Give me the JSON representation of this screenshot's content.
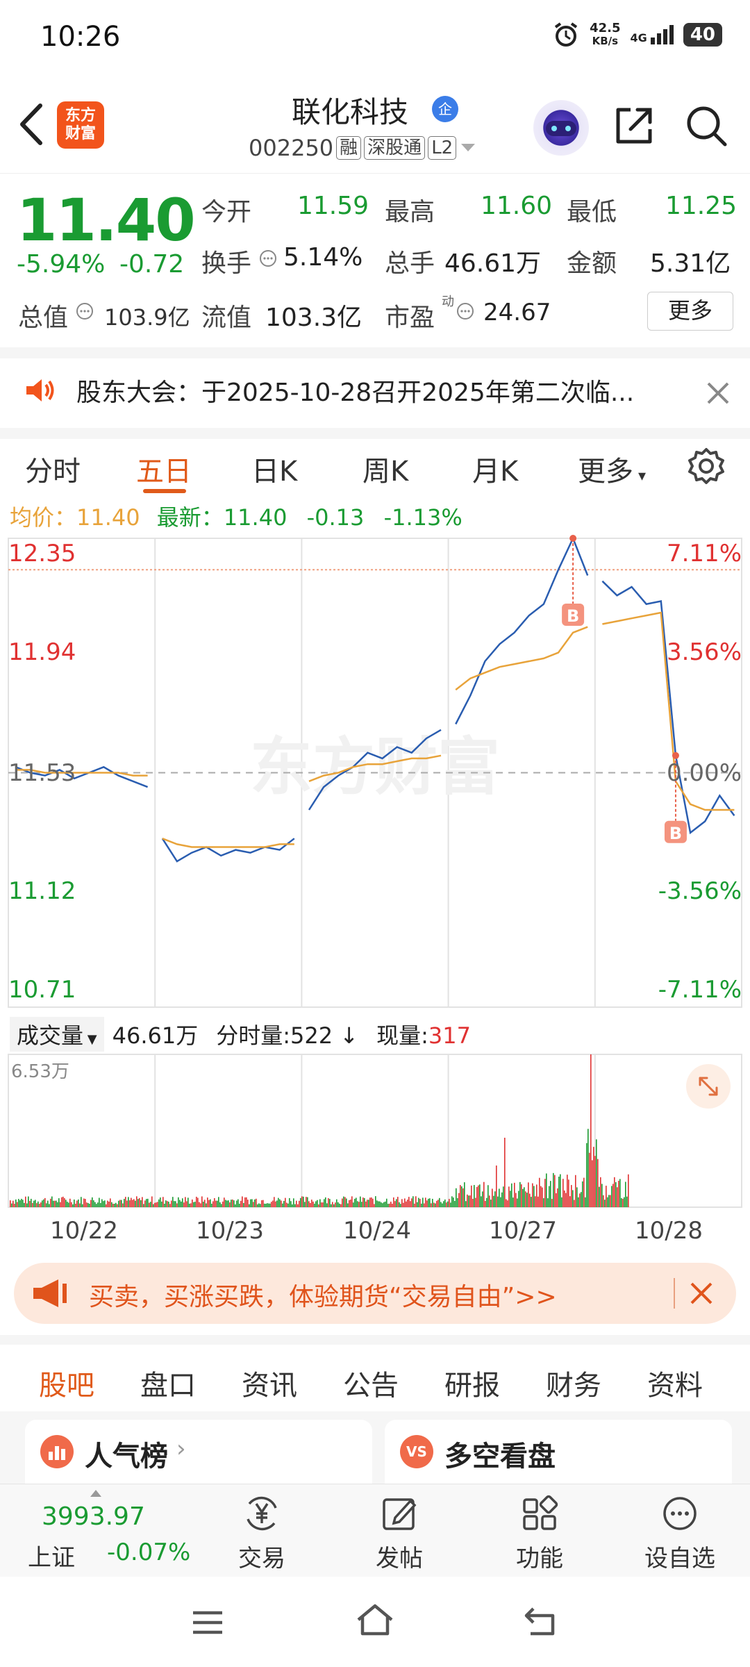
{
  "status_bar": {
    "time": "10:26",
    "net_speed": "42.5",
    "net_unit": "KB/s",
    "network": "4G",
    "battery": "40"
  },
  "header": {
    "stock_name": "联化科技",
    "qi_badge": "企",
    "stock_code": "002250",
    "tags": [
      "融",
      "深股通",
      "L2"
    ],
    "logo_line1": "东方",
    "logo_line2": "财富"
  },
  "quote": {
    "price": "11.40",
    "change_pct": "-5.94%",
    "change": "-0.72",
    "open_label": "今开",
    "open": "11.59",
    "high_label": "最高",
    "high": "11.60",
    "low_label": "最低",
    "low": "11.25",
    "turnover_label": "换手",
    "turnover": "5.14%",
    "volume_label": "总手",
    "volume": "46.61万",
    "amount_label": "金额",
    "amount": "5.31亿",
    "mcap_label": "总值",
    "mcap": "103.9亿",
    "float_label": "流值",
    "float_cap": "103.3亿",
    "pe_label": "市盈",
    "pe_sup": "动",
    "pe": "24.67",
    "more_label": "更多"
  },
  "notice": {
    "text": "股东大会：于2025-10-28召开2025年第二次临..."
  },
  "chart_tabs": [
    "分时",
    "五日",
    "日K",
    "周K",
    "月K",
    "更多"
  ],
  "avg_line": {
    "avg_label": "均价：",
    "avg": "11.40",
    "latest_label": "最新：",
    "latest": "11.40",
    "chg": "-0.13",
    "pct": "-1.13%"
  },
  "chart_data": {
    "type": "line",
    "title": "",
    "x": [
      "10/22",
      "10/23",
      "10/24",
      "10/27",
      "10/28"
    ],
    "ylim": [
      10.71,
      12.35
    ],
    "y_ticks_left": [
      "12.35",
      "11.94",
      "11.53",
      "11.12",
      "10.71"
    ],
    "y_ticks_right": [
      "7.11%",
      "3.56%",
      "0.00%",
      "-3.56%",
      "-7.11%"
    ],
    "base_price": 11.53,
    "series": [
      {
        "name": "",
        "color": "#2a5db0",
        "values": [
          11.55,
          11.53,
          11.52,
          11.54,
          11.51,
          11.53,
          11.55,
          11.52,
          11.5,
          11.48,
          11.3,
          11.22,
          11.25,
          11.27,
          11.24,
          11.26,
          11.25,
          11.27,
          11.26,
          11.3,
          11.4,
          11.48,
          11.52,
          11.55,
          11.6,
          11.58,
          11.62,
          11.6,
          11.65,
          11.68,
          11.7,
          11.8,
          11.92,
          11.98,
          12.02,
          12.08,
          12.12,
          12.24,
          12.35,
          12.22,
          12.2,
          12.15,
          12.18,
          12.12,
          12.13,
          11.59,
          11.32,
          11.36,
          11.45,
          11.38
        ]
      },
      {
        "name": "",
        "color": "#e8a33a",
        "values": [
          11.54,
          11.54,
          11.53,
          11.53,
          11.53,
          11.53,
          11.53,
          11.53,
          11.52,
          11.52,
          11.3,
          11.28,
          11.27,
          11.27,
          11.27,
          11.27,
          11.27,
          11.27,
          11.28,
          11.28,
          11.5,
          11.52,
          11.53,
          11.55,
          11.56,
          11.56,
          11.57,
          11.58,
          11.58,
          11.59,
          11.82,
          11.86,
          11.88,
          11.9,
          11.91,
          11.92,
          11.93,
          11.95,
          12.02,
          12.04,
          12.05,
          12.06,
          12.07,
          12.08,
          12.09,
          11.5,
          11.42,
          11.4,
          11.4,
          11.4
        ]
      }
    ],
    "markers": [
      {
        "label": "B",
        "series_index": 0,
        "point": 38
      },
      {
        "label": "B",
        "series_index": 0,
        "point": 45
      }
    ],
    "watermark": "东方财富"
  },
  "volume": {
    "select_label": "成交量",
    "total": "46.61万",
    "tick_label": "分时量:",
    "tick_value": "522",
    "current_label": "现量:",
    "current_value": "317",
    "max_label": "6.53万"
  },
  "ad": {
    "text": "买卖，买涨买跌，体验期货“交易自由”>>"
  },
  "info_tabs": [
    "股吧",
    "盘口",
    "资讯",
    "公告",
    "研报",
    "财务",
    "资料"
  ],
  "cards": [
    {
      "title": "人气榜"
    },
    {
      "title": "多空看盘"
    }
  ],
  "bottom_nav": {
    "index_value": "3993.97",
    "index_name": "上证",
    "index_pct": "-0.07%",
    "items": [
      "交易",
      "发帖",
      "功能",
      "设自选"
    ]
  }
}
